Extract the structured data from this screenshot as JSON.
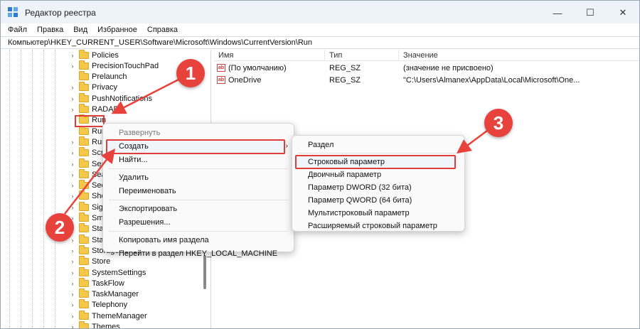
{
  "window": {
    "title": "Редактор реестра",
    "controls": {
      "minimize": "—",
      "maximize": "☐",
      "close": "✕"
    }
  },
  "menubar": [
    "Файл",
    "Правка",
    "Вид",
    "Избранное",
    "Справка"
  ],
  "address": "Компьютер\\HKEY_CURRENT_USER\\Software\\Microsoft\\Windows\\CurrentVersion\\Run",
  "tree": {
    "items": [
      {
        "label": "Policies",
        "expandable": true
      },
      {
        "label": "PrecisionTouchPad",
        "expandable": true
      },
      {
        "label": "Prelaunch",
        "expandable": false
      },
      {
        "label": "Privacy",
        "expandable": true
      },
      {
        "label": "PushNotifications",
        "expandable": true
      },
      {
        "label": "RADAR",
        "expandable": true
      },
      {
        "label": "Run",
        "expandable": false,
        "selected": true
      },
      {
        "label": "Run",
        "expandable": false
      },
      {
        "label": "Run",
        "expandable": true
      },
      {
        "label": "Scre",
        "expandable": true
      },
      {
        "label": "Sea",
        "expandable": true
      },
      {
        "label": "Sear",
        "expandable": true
      },
      {
        "label": "Secu",
        "expandable": true
      },
      {
        "label": "Shel",
        "expandable": true
      },
      {
        "label": "Sign",
        "expandable": true
      },
      {
        "label": "Sma",
        "expandable": true
      },
      {
        "label": "Star",
        "expandable": true
      },
      {
        "label": "Star",
        "expandable": true
      },
      {
        "label": "StorageSense",
        "expandable": true
      },
      {
        "label": "Store",
        "expandable": true
      },
      {
        "label": "SystemSettings",
        "expandable": true
      },
      {
        "label": "TaskFlow",
        "expandable": true
      },
      {
        "label": "TaskManager",
        "expandable": true
      },
      {
        "label": "Telephony",
        "expandable": true
      },
      {
        "label": "ThemeManager",
        "expandable": true
      },
      {
        "label": "Themes",
        "expandable": true
      }
    ]
  },
  "list": {
    "columns": [
      "Имя",
      "Тип",
      "Значение"
    ],
    "rows": [
      {
        "icon": "ab",
        "name": "(По умолчанию)",
        "type": "REG_SZ",
        "value": "(значение не присвоено)"
      },
      {
        "icon": "ab",
        "name": "OneDrive",
        "type": "REG_SZ",
        "value": "\"C:\\Users\\Almanex\\AppData\\Local\\Microsoft\\One..."
      }
    ]
  },
  "context_menu": {
    "items": [
      {
        "label": "Развернуть",
        "disabled": true
      },
      {
        "label": "Создать",
        "submenu": true,
        "highlighted": true
      },
      {
        "label": "Найти..."
      },
      {
        "separator": true
      },
      {
        "label": "Удалить"
      },
      {
        "label": "Переименовать"
      },
      {
        "separator": true
      },
      {
        "label": "Экспортировать"
      },
      {
        "label": "Разрешения..."
      },
      {
        "separator": true
      },
      {
        "label": "Копировать имя раздела"
      },
      {
        "label": "Перейти в раздел HKEY_LOCAL_MACHINE"
      }
    ]
  },
  "submenu": {
    "items": [
      {
        "label": "Раздел"
      },
      {
        "separator": true
      },
      {
        "label": "Строковый параметр",
        "highlighted": true
      },
      {
        "label": "Двоичный параметр"
      },
      {
        "label": "Параметр DWORD (32 бита)"
      },
      {
        "label": "Параметр QWORD (64 бита)"
      },
      {
        "label": "Мультистроковый параметр"
      },
      {
        "label": "Расширяемый строковый параметр"
      }
    ]
  },
  "annotations": {
    "badge1": "1",
    "badge2": "2",
    "badge3": "3",
    "color": "#e8423c"
  }
}
